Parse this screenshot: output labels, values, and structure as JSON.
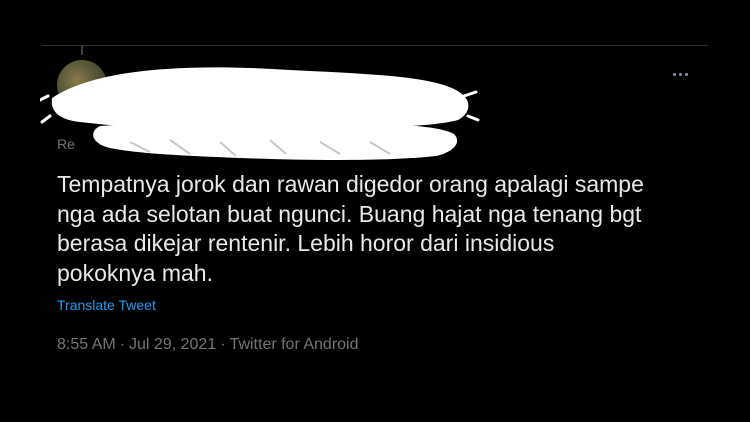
{
  "tweet": {
    "replying_prefix": "Re",
    "replying_handle": "",
    "text": "Tempatnya jorok dan rawan digedor orang apalagi sampe\nnga ada selotan buat ngunci. Buang hajat nga tenang bgt\nberasa dikejar rentenir. Lebih horor dari insidious\npokoknya mah.",
    "translate_label": "Translate Tweet",
    "time": "8:55 AM",
    "separator": "·",
    "date": "Jul 29, 2021",
    "source": "Twitter for Android"
  },
  "icons": {
    "more": "more-horizontal-icon"
  },
  "colors": {
    "background": "#000000",
    "text": "#e7e9ea",
    "muted": "#71767b",
    "link": "#1d9bf0",
    "divider": "#2f3336"
  }
}
